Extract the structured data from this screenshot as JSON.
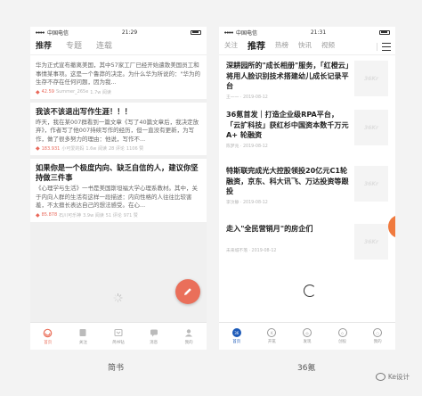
{
  "left_phone": {
    "status": {
      "carrier": "中国电信",
      "time": "21:29"
    },
    "tabs": [
      {
        "label": "推荐",
        "active": true
      },
      {
        "label": "专题",
        "active": false
      },
      {
        "label": "连载",
        "active": false
      }
    ],
    "cards": [
      {
        "title": "",
        "excerpt": "华为正式宣布撤离美国，其中57家工厂已经开始遣散美国员工和事情某事项。这是一个鲁莽的决定。为什么华为所说的：\"华为的生存不存在任何问题，因为我...",
        "meta": {
          "stat": "42.59",
          "author": "Summer_265e",
          "reads": "1.7w 阅读",
          "comments": "",
          "likes": ""
        }
      },
      {
        "title": "我该不该退出写作生涯！！！",
        "excerpt": "昨天，我在某007群看到一篇文章《写了40篇文章后，我决定放弃》，作者写了他007持续写作的经历，但一直没有更新，为写作，做了很多努力的理由：他说，写作不...",
        "meta": {
          "stat": "183.931",
          "author": "小可爱的妈",
          "reads": "1.6w 阅读",
          "comments": "28 评论",
          "likes": "1106 赞"
        }
      },
      {
        "title": "如果你是一个极度内向、缺乏自信的人，建议你坚持做三件事",
        "excerpt": "《心理学与生活》一书是美国斯坦福大学心理系教材。其中，关于内向人群的生活有这样一段描述：内向性格的人往往比较害羞，不太擅长表达自己的想法感受。在心...",
        "meta": {
          "stat": "85.878",
          "author": "石川可乐神",
          "reads": "3.9w 阅读",
          "comments": "51 评论",
          "likes": "971 赞"
        }
      }
    ],
    "tabbar": [
      {
        "label": "首页",
        "icon": "home-icon",
        "active": true
      },
      {
        "label": "关注",
        "icon": "bookmark-icon",
        "active": false
      },
      {
        "label": "简书钻",
        "icon": "diamond-icon",
        "active": false
      },
      {
        "label": "消息",
        "icon": "message-icon",
        "active": false
      },
      {
        "label": "我的",
        "icon": "user-icon",
        "active": false
      }
    ],
    "caption": "简书"
  },
  "right_phone": {
    "status": {
      "carrier": "中国电信",
      "time": "21:31"
    },
    "tabs": [
      {
        "label": "关注",
        "active": false
      },
      {
        "label": "推荐",
        "active": true
      },
      {
        "label": "热榜",
        "active": false
      },
      {
        "label": "快讯",
        "active": false
      },
      {
        "label": "视频",
        "active": false
      }
    ],
    "items": [
      {
        "title": "深耕园所的\"成长相册\"服务，「红橙云」将用人脸识别技术搭建幼儿成长记录平台",
        "meta": "王一一 · 2019-08-12"
      },
      {
        "title": "36氪首发｜打造企业级RPA平台，「云扩科技」获红杉中国资本数千万元 A+ 轮融资",
        "meta": "陈梦兆 · 2019-08-12"
      },
      {
        "title": "特斯联完成光大控股领投20亿元C1轮融资，京东、科大讯飞、万达投资等跟投",
        "meta": "李汶静 · 2019-08-12"
      },
      {
        "title": "走入\"全民营销月\"的房企们",
        "meta": "未来城不落 · 2019-08-12"
      }
    ],
    "thumb_text": "36Kr",
    "tabbar": [
      {
        "label": "首页",
        "glyph": "36",
        "active": true
      },
      {
        "label": "开氪",
        "glyph": "K",
        "active": false
      },
      {
        "label": "发现",
        "glyph": "◎",
        "active": false
      },
      {
        "label": "创投",
        "glyph": "◇",
        "active": false
      },
      {
        "label": "我的",
        "glyph": "○",
        "active": false
      }
    ],
    "caption": "36氪"
  },
  "watermark": "Ke设计",
  "colors": {
    "jianshu_accent": "#ea6f5a",
    "kr_accent": "#1d5ab8",
    "kr_orange": "#f07a3e"
  }
}
